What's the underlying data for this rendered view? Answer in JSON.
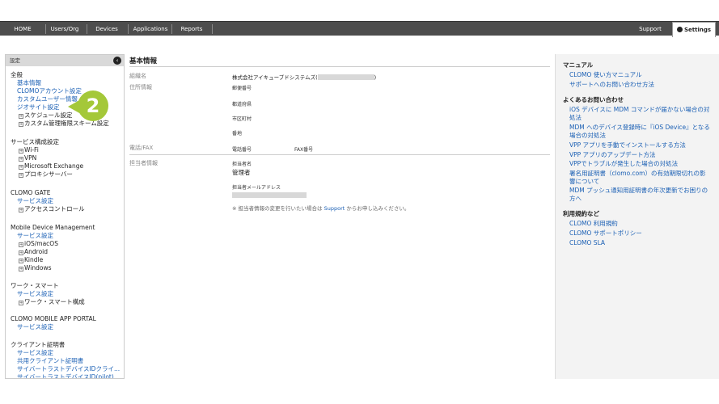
{
  "nav": {
    "items": [
      "HOME",
      "Users/Org",
      "Devices",
      "Applications",
      "Reports"
    ],
    "support": "Support",
    "settings": "Settings"
  },
  "sidebar": {
    "header": "設定",
    "lines": [
      {
        "text": "全般",
        "kind": "sec"
      },
      {
        "text": "基本情報",
        "kind": "link"
      },
      {
        "text": "CLOMOアカウント設定",
        "kind": "link"
      },
      {
        "text": "カスタムユーザー情報",
        "kind": "link"
      },
      {
        "text": "ジオサイト設定",
        "kind": "link"
      },
      {
        "text": "スケジュール設定",
        "kind": "tree"
      },
      {
        "text": "カスタム管理権限スキーム設定",
        "kind": "tree"
      },
      {
        "text": "サービス構成設定",
        "kind": "sec"
      },
      {
        "text": "Wi-Fi",
        "kind": "tree"
      },
      {
        "text": "VPN",
        "kind": "tree"
      },
      {
        "text": "Microsoft Exchange",
        "kind": "tree"
      },
      {
        "text": "プロキシサーバー",
        "kind": "tree"
      },
      {
        "text": "CLOMO GATE",
        "kind": "sec"
      },
      {
        "text": "サービス設定",
        "kind": "link"
      },
      {
        "text": "アクセスコントロール",
        "kind": "tree"
      },
      {
        "text": "Mobile Device Management",
        "kind": "sec"
      },
      {
        "text": "サービス設定",
        "kind": "link"
      },
      {
        "text": "iOS/macOS",
        "kind": "tree"
      },
      {
        "text": "Android",
        "kind": "tree"
      },
      {
        "text": "Kindle",
        "kind": "tree"
      },
      {
        "text": "Windows",
        "kind": "tree"
      },
      {
        "text": "ワーク・スマート",
        "kind": "sec"
      },
      {
        "text": "サービス設定",
        "kind": "link"
      },
      {
        "text": "ワーク・スマート構成",
        "kind": "tree"
      },
      {
        "text": "CLOMO MOBILE APP PORTAL",
        "kind": "sec"
      },
      {
        "text": "サービス設定",
        "kind": "link"
      },
      {
        "text": "クライアント証明書",
        "kind": "sec"
      },
      {
        "text": "サービス設定",
        "kind": "link"
      },
      {
        "text": "共用クライアント証明書",
        "kind": "link"
      },
      {
        "text": "サイバートラストデバイスIDクライ...",
        "kind": "link"
      },
      {
        "text": "サイバートラストデバイスID(pilot)",
        "kind": "link"
      }
    ],
    "callout_number": "2"
  },
  "main": {
    "title": "基本情報",
    "org_label": "組織名",
    "org_value_prefix": "株式会社アイキューブドシステムズ(",
    "org_value_suffix": ")",
    "address_label": "住所情報",
    "postal": "郵便番号",
    "prefecture": "都道府県",
    "city": "市区町村",
    "street": "番地",
    "phone_label": "電話/FAX",
    "phone": "電話番号",
    "fax": "FAX番号",
    "contact_label": "担当者情報",
    "contact_name_label": "担当者名",
    "contact_name": "管理者",
    "contact_email_label": "担当者メールアドレス",
    "note_prefix": "※ 担当者情報の変更を行いたい場合は ",
    "note_link": "Support",
    "note_suffix": " からお申し込みください。"
  },
  "right": {
    "manual_heading": "マニュアル",
    "manual_links": [
      "CLOMO 使い方マニュアル",
      "サポートへのお問い合わせ方法"
    ],
    "faq_heading": "よくあるお問い合わせ",
    "faq_links": [
      "iOS デバイスに MDM コマンドが届かない場合の対処法",
      "MDM へのデバイス登録時に『iOS Device』となる場合の対処法",
      "VPP アプリを手動でインストールする方法",
      "VPP アプリのアップデート方法",
      "VPPでトラブルが発生した場合の対処法",
      "署名用証明書（clomo.com）の有効期限切れの影響について",
      "MDM プッシュ通知用証明書の年次更新でお困りの方へ"
    ],
    "terms_heading": "利用規約など",
    "terms_links": [
      "CLOMO 利用規約",
      "CLOMO サポートポリシー",
      "CLOMO SLA"
    ]
  }
}
